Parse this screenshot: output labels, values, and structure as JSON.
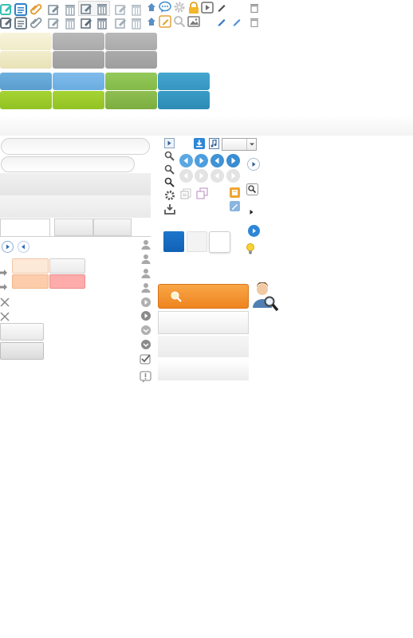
{
  "sprite": {
    "toolbar_icons_row1": [
      "edit-icon",
      "list-icon",
      "paperclip-icon",
      "edit-icon",
      "trash-icon",
      "edit-icon",
      "trash-icon",
      "edit-icon",
      "trash-icon",
      "home-icon",
      "chat-icon",
      "gear-icon",
      "lock-icon",
      "play-icon",
      "pencil-icon",
      "trash-icon"
    ],
    "toolbar_icons_row2": [
      "edit-icon",
      "list-icon",
      "paperclip-icon",
      "edit-icon",
      "trash-icon",
      "edit-icon",
      "trash-icon",
      "edit-icon",
      "trash-icon",
      "home-icon",
      "edit-icon",
      "search-icon",
      "image-icon",
      "pencil-icon",
      "pencil-icon",
      "trash-icon"
    ],
    "colors": {
      "cream": "#f3efcf",
      "grey": "#b1b1b1",
      "blue": "#66a7d6",
      "lightblue": "#75b4e6",
      "green": "#8cc251",
      "lime": "#9ccc2b",
      "teal": "#3d9dc8",
      "orange": "#f08a1c",
      "peach": "#fde3cc",
      "pink": "#fdb1b1",
      "darkblue": "#1a6fc4",
      "accent": "#2d86d8"
    },
    "select_value": ""
  }
}
